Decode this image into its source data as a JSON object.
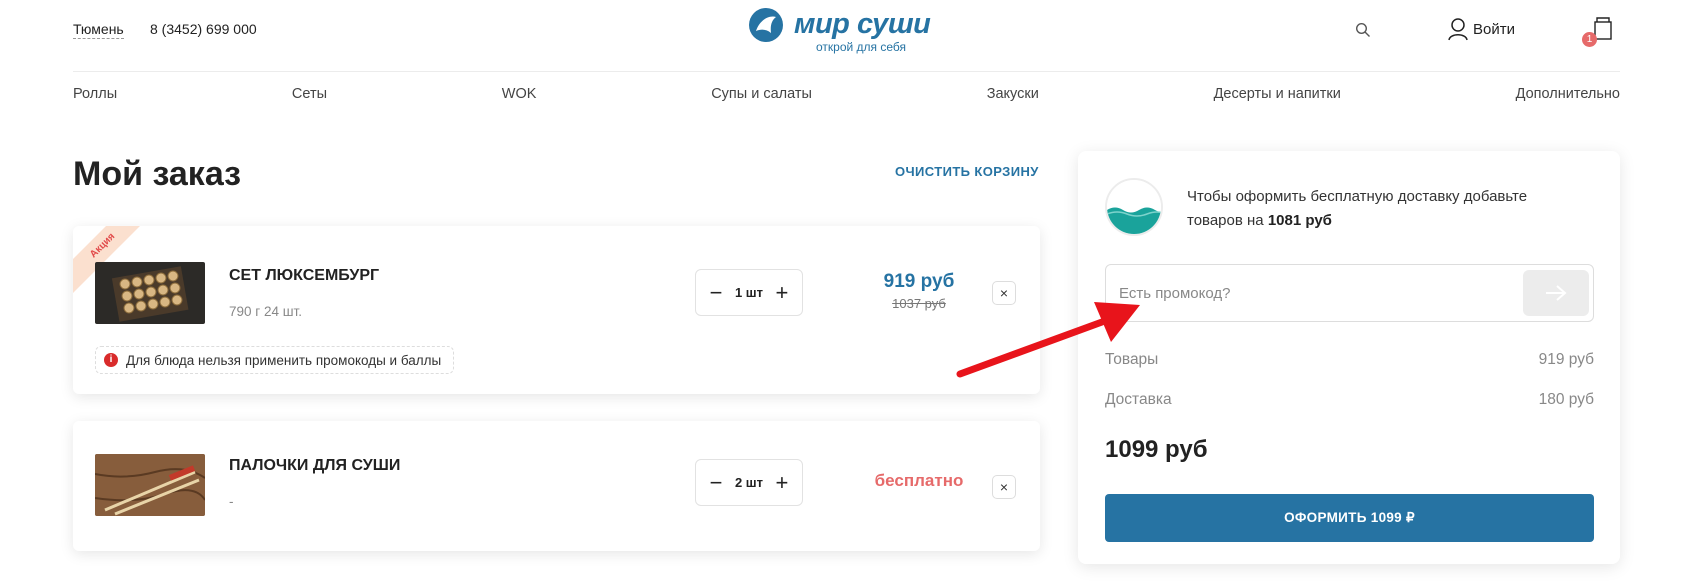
{
  "header": {
    "city": "Тюмень",
    "phone": "8 (3452) 699 000",
    "logo_title": "мир суши",
    "logo_subtitle": "открой для себя",
    "login_label": "Войти",
    "cart_count": "1"
  },
  "nav": {
    "items": [
      "Роллы",
      "Сеты",
      "WOK",
      "Супы и салаты",
      "Закуски",
      "Десерты и напитки",
      "Дополнительно"
    ]
  },
  "order": {
    "title": "Мой заказ",
    "clear_label": "ОЧИСТИТЬ КОРЗИНУ",
    "items": [
      {
        "badge": "Акция",
        "name": "СЕТ ЛЮКСЕМБУРГ",
        "meta": "790 г 24 шт.",
        "quantity": "1 шт",
        "price": "919 руб",
        "old_price": "1037 руб",
        "remove": "×",
        "note": "Для блюда нельзя применить промокоды и баллы",
        "note_icon": "i"
      },
      {
        "name": "ПАЛОЧКИ ДЛЯ СУШИ",
        "meta": "-",
        "quantity": "2 шт",
        "price": "бесплатно",
        "remove": "×"
      }
    ],
    "stepper_minus": "−",
    "stepper_plus": "+"
  },
  "summary": {
    "free_delivery_text": "Чтобы оформить бесплатную доставку добавьте товаров на",
    "free_delivery_amount": "1081 руб",
    "promo_placeholder": "Есть промокод?",
    "goods_label": "Товары",
    "goods_value": "919 руб",
    "delivery_label": "Доставка",
    "delivery_value": "180 руб",
    "total": "1099 руб",
    "checkout_label": "ОФОРМИТЬ 1099 ₽"
  },
  "colors": {
    "accent": "#2673a3",
    "free_price": "#e66a6a",
    "badge": "#e66a6a",
    "annotation_arrow": "#e8141b",
    "wave": "#1aa39b"
  },
  "icons": [
    "logo-mark-icon",
    "search-icon",
    "user-icon",
    "cart-icon",
    "info-icon",
    "close-icon",
    "arrow-right-icon",
    "annotation-arrow"
  ]
}
